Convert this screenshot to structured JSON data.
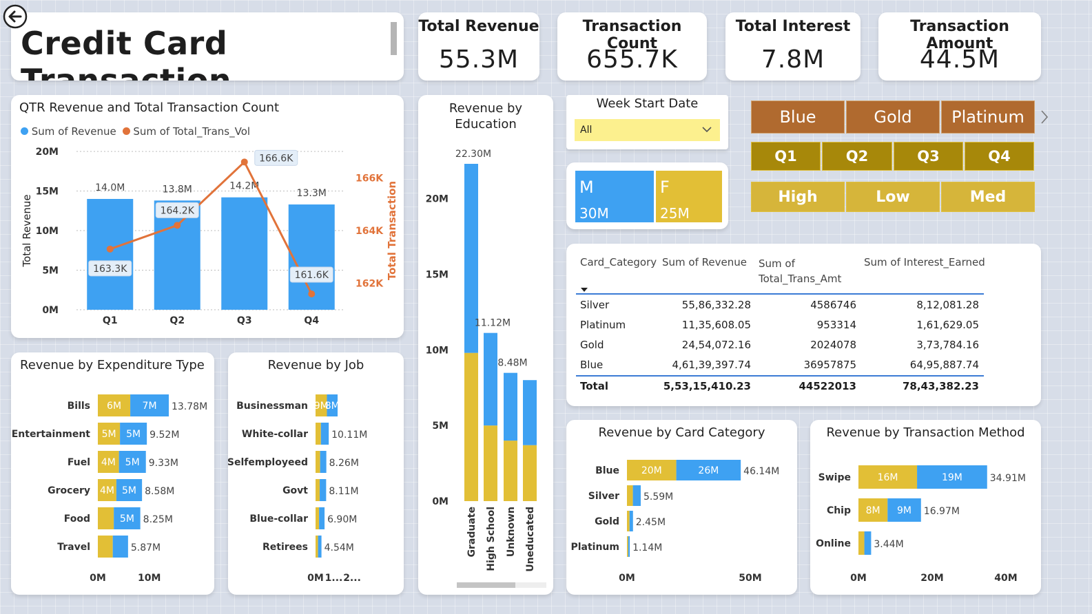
{
  "header": {
    "title": "Credit Card Transaction",
    "back_icon": "back-arrow-icon"
  },
  "kpis": [
    {
      "title": "Total Revenue",
      "value": "55.3M"
    },
    {
      "title": "Transaction Count",
      "value": "655.7K"
    },
    {
      "title": "Total Interest",
      "value": "7.8M"
    },
    {
      "title": "Transaction Amount",
      "value": "44.5M"
    }
  ],
  "colors": {
    "blue": "#3ea1f2",
    "gold": "#e2bf36",
    "orange": "#e1733a",
    "slicer_brown": "#b06a2f",
    "slicer_olive": "#a7880a",
    "slicer_gold": "#d6b53a"
  },
  "week_slicer": {
    "title": "Week Start Date",
    "value": "All"
  },
  "gender": [
    {
      "label": "M",
      "value": "30M"
    },
    {
      "label": "F",
      "value": "25M"
    }
  ],
  "card_slicer": {
    "items": [
      "Blue",
      "Gold",
      "Platinum"
    ],
    "more_icon": "chevron-right-icon"
  },
  "quarter_slicer": {
    "items": [
      "Q1",
      "Q2",
      "Q3",
      "Q4"
    ]
  },
  "level_slicer": {
    "items": [
      "High",
      "Low",
      "Med"
    ]
  },
  "table": {
    "headers": [
      "Card_Category",
      "Sum of Revenue",
      "Sum of",
      "Total_Trans_Amt",
      "Sum of Interest_Earned"
    ],
    "rows": [
      [
        "Silver",
        "55,86,332.28",
        "4586746",
        "8,12,081.28"
      ],
      [
        "Platinum",
        "11,35,608.05",
        "953314",
        "1,61,629.05"
      ],
      [
        "Gold",
        "24,54,072.16",
        "2024078",
        "3,73,784.16"
      ],
      [
        "Blue",
        "4,61,39,397.74",
        "36957875",
        "64,95,887.74"
      ]
    ],
    "total": [
      "Total",
      "5,53,15,410.23",
      "44522013",
      "78,43,382.23"
    ]
  },
  "chart_data": [
    {
      "id": "qtr",
      "type": "bar+line",
      "title": "QTR Revenue and Total Transaction Count",
      "categories": [
        "Q1",
        "Q2",
        "Q3",
        "Q4"
      ],
      "series": [
        {
          "name": "Sum of Revenue",
          "values": [
            14.0,
            13.8,
            14.2,
            13.3
          ],
          "labels": [
            "14.0M",
            "13.8M",
            "14.2M",
            "13.3M"
          ]
        },
        {
          "name": "Sum of Total_Trans_Vol",
          "values": [
            163.3,
            164.2,
            166.6,
            161.6
          ],
          "labels": [
            "163.3K",
            "164.2K",
            "166.6K",
            "161.6K"
          ]
        }
      ],
      "ylabel": "Total Revenue",
      "y2label": "Total Transaction",
      "yticks": [
        "0M",
        "5M",
        "10M",
        "15M",
        "20M"
      ],
      "ylim": [
        0,
        20
      ],
      "y2ticks": [
        "162K",
        "164K",
        "166K"
      ],
      "y2lim": [
        161,
        167
      ]
    },
    {
      "id": "education",
      "type": "stacked-bar",
      "title": "Revenue by Education",
      "categories": [
        "Graduate",
        "High School",
        "Unknown",
        "Uneducated"
      ],
      "series": [
        {
          "name": "gold",
          "values": [
            9.8,
            5.0,
            4.0,
            3.7
          ]
        },
        {
          "name": "blue",
          "values": [
            12.5,
            6.12,
            4.48,
            4.3
          ]
        }
      ],
      "totals": [
        "22.30M",
        "11.12M",
        "8.48M",
        ""
      ],
      "yticks": [
        "0M",
        "5M",
        "10M",
        "15M",
        "20M"
      ],
      "ylim": [
        0,
        22.3
      ]
    },
    {
      "id": "expenditure",
      "type": "stacked-hbar",
      "title": "Revenue by Expenditure Type",
      "categories": [
        "Bills",
        "Entertainment",
        "Fuel",
        "Grocery",
        "Food",
        "Travel"
      ],
      "series": [
        {
          "name": "gold",
          "values": [
            6.3,
            4.3,
            4.1,
            3.6,
            3.1,
            2.9
          ],
          "labels": [
            "6M",
            "5M",
            "4M",
            "4M",
            "",
            ""
          ]
        },
        {
          "name": "blue",
          "values": [
            7.48,
            5.22,
            5.23,
            4.98,
            5.15,
            2.97
          ],
          "labels": [
            "7M",
            "5M",
            "5M",
            "5M",
            "5M",
            ""
          ]
        }
      ],
      "totals": [
        "13.78M",
        "9.52M",
        "9.33M",
        "8.58M",
        "8.25M",
        "5.87M"
      ],
      "xticks": [
        "0M",
        "10M"
      ],
      "xlim": [
        0,
        19
      ]
    },
    {
      "id": "job",
      "type": "stacked-hbar",
      "title": "Revenue by Job",
      "categories": [
        "Businessman",
        "White-collar",
        "Selfemployeed",
        "Govt",
        "Blue-collar",
        "Retirees"
      ],
      "series": [
        {
          "name": "gold",
          "values": [
            8.7,
            4.1,
            3.5,
            3.2,
            2.7,
            1.9
          ],
          "labels": [
            "9M",
            "",
            "",
            "",
            "",
            ""
          ]
        },
        {
          "name": "blue",
          "values": [
            8.2,
            6.01,
            4.76,
            4.91,
            4.2,
            2.64
          ],
          "labels": [
            "8M",
            "",
            "",
            "",
            "",
            ""
          ]
        }
      ],
      "totals": [
        "",
        "10.11M",
        "8.26M",
        "8.11M",
        "6.90M",
        "4.54M"
      ],
      "xticks": [
        "0M",
        "1...",
        "2..."
      ],
      "xlim": [
        0,
        38
      ]
    },
    {
      "id": "cardcat",
      "type": "stacked-hbar",
      "title": "Revenue by Card Category",
      "categories": [
        "Blue",
        "Silver",
        "Gold",
        "Platinum"
      ],
      "series": [
        {
          "name": "gold",
          "values": [
            20.0,
            2.4,
            1.05,
            0.5
          ],
          "labels": [
            "20M",
            "",
            "",
            ""
          ]
        },
        {
          "name": "blue",
          "values": [
            26.14,
            3.19,
            1.4,
            0.64
          ],
          "labels": [
            "26M",
            "",
            "",
            ""
          ]
        }
      ],
      "totals": [
        "46.14M",
        "5.59M",
        "2.45M",
        "1.14M"
      ],
      "xticks": [
        "0M",
        "50M"
      ],
      "xlim": [
        0,
        50
      ]
    },
    {
      "id": "method",
      "type": "stacked-hbar",
      "title": "Revenue by Transaction Method",
      "categories": [
        "Swipe",
        "Chip",
        "Online"
      ],
      "series": [
        {
          "name": "gold",
          "values": [
            15.9,
            7.9,
            1.6
          ],
          "labels": [
            "16M",
            "8M",
            ""
          ]
        },
        {
          "name": "blue",
          "values": [
            19.01,
            9.07,
            1.84
          ],
          "labels": [
            "19M",
            "9M",
            ""
          ]
        }
      ],
      "totals": [
        "34.91M",
        "16.97M",
        "3.44M"
      ],
      "xticks": [
        "0M",
        "20M",
        "40M"
      ],
      "xlim": [
        0,
        40
      ]
    }
  ]
}
